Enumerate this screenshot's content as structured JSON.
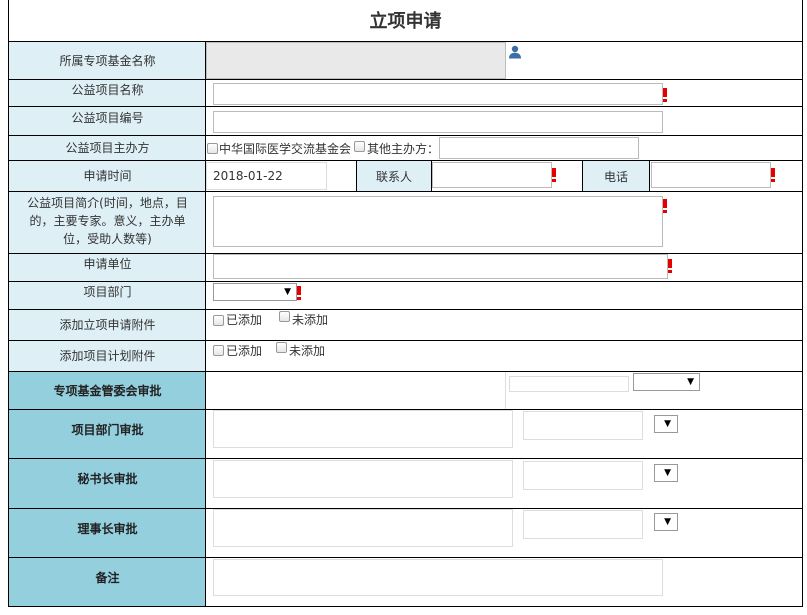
{
  "title": "立项申请",
  "rows": {
    "fund_name": {
      "label": "所属专项基金名称"
    },
    "project_name": {
      "label": "公益项目名称"
    },
    "project_code": {
      "label": "公益项目编号"
    },
    "organizer": {
      "label": "公益项目主办方",
      "option1": "中华国际医学交流基金会",
      "option2": "其他主办方："
    },
    "apply_time": {
      "label": "申请时间",
      "value": "2018-01-22",
      "contact_label": "联系人",
      "phone_label": "电话"
    },
    "summary": {
      "label": "公益项目简介(时间，地点，目的，主要专家。意义，主办单位，受助人数等)"
    },
    "apply_unit": {
      "label": "申请单位"
    },
    "department": {
      "label": "项目部门"
    },
    "apply_attachment": {
      "label": "添加立项申请附件",
      "added": "已添加",
      "not_added": "未添加"
    },
    "plan_attachment": {
      "label": "添加项目计划附件",
      "added": "已添加",
      "not_added": "未添加"
    }
  },
  "approvals": {
    "fund_committee": "专项基金管委会审批",
    "department": "项目部门审批",
    "secretary_general": "秘书长审批",
    "chairman": "理事长审批",
    "remarks": "备注"
  },
  "icons": {
    "user": "user-icon",
    "required": "required-mark-icon",
    "dropdown": "dropdown-arrow-icon"
  },
  "colors": {
    "label_bg": "#deeff6",
    "approval_bg": "#94cfde",
    "required": "#e60000",
    "user_icon": "#3a6ea5"
  }
}
